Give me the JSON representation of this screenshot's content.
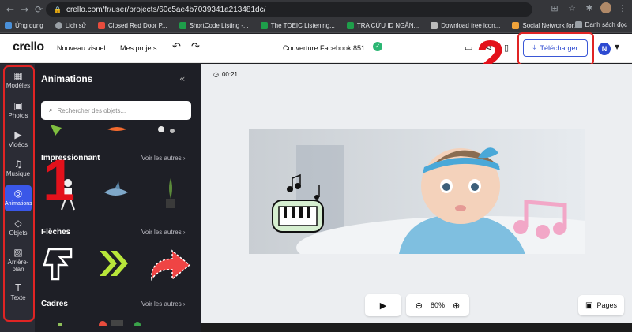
{
  "browser": {
    "url": "crello.com/fr/user/projects/60c5ae4b7039341a213481dc/",
    "bookmarks": [
      {
        "label": "Ứng dụng",
        "color": "#4a90d9"
      },
      {
        "label": "Lịch sử",
        "color": "#9aa0a6"
      },
      {
        "label": "Closed Red Door P...",
        "color": "#e84c3d"
      },
      {
        "label": "ShortCode Listing -...",
        "color": "#1e9e4a"
      },
      {
        "label": "The TOEIC Listening...",
        "color": "#1e9e4a"
      },
      {
        "label": "TRA CỨU ID NGÂN...",
        "color": "#1e9e4a"
      },
      {
        "label": "Download free icon...",
        "color": "#bbbbbb"
      },
      {
        "label": "Social Network for...",
        "color": "#f0a33a"
      }
    ],
    "reading_list": "Danh sách đọc"
  },
  "header": {
    "logo": "crello",
    "new_visual": "Nouveau visuel",
    "my_projects": "Mes projets",
    "doc_title": "Couverture Facebook 851...",
    "download_label": "Télécharger",
    "user_initial": "N",
    "annotation_number": "2"
  },
  "rail": {
    "items": [
      {
        "label": "Modèles",
        "icon": "▦"
      },
      {
        "label": "Photos",
        "icon": "▣"
      },
      {
        "label": "Vidéos",
        "icon": "▶"
      },
      {
        "label": "Musique",
        "icon": "♫"
      },
      {
        "label": "Animations",
        "icon": "◎"
      },
      {
        "label": "Objets",
        "icon": "◇"
      },
      {
        "label": "Arrière-",
        "label2": "plan",
        "icon": "▨"
      },
      {
        "label": "Texte",
        "icon": "T"
      }
    ],
    "annotation_number": "1"
  },
  "panel": {
    "title": "Animations",
    "search_placeholder": "Rechercher des objets...",
    "sections": [
      {
        "title": "Impressionnant",
        "see_all": "Voir les autres"
      },
      {
        "title": "Flèches",
        "see_all": "Voir les autres"
      },
      {
        "title": "Cadres",
        "see_all": "Voir les autres"
      }
    ]
  },
  "canvas": {
    "time": "00:21",
    "zoom": "80%",
    "pages_label": "Pages"
  },
  "colors": {
    "accent": "#3a57e8",
    "annotation_red": "#e3111b"
  }
}
